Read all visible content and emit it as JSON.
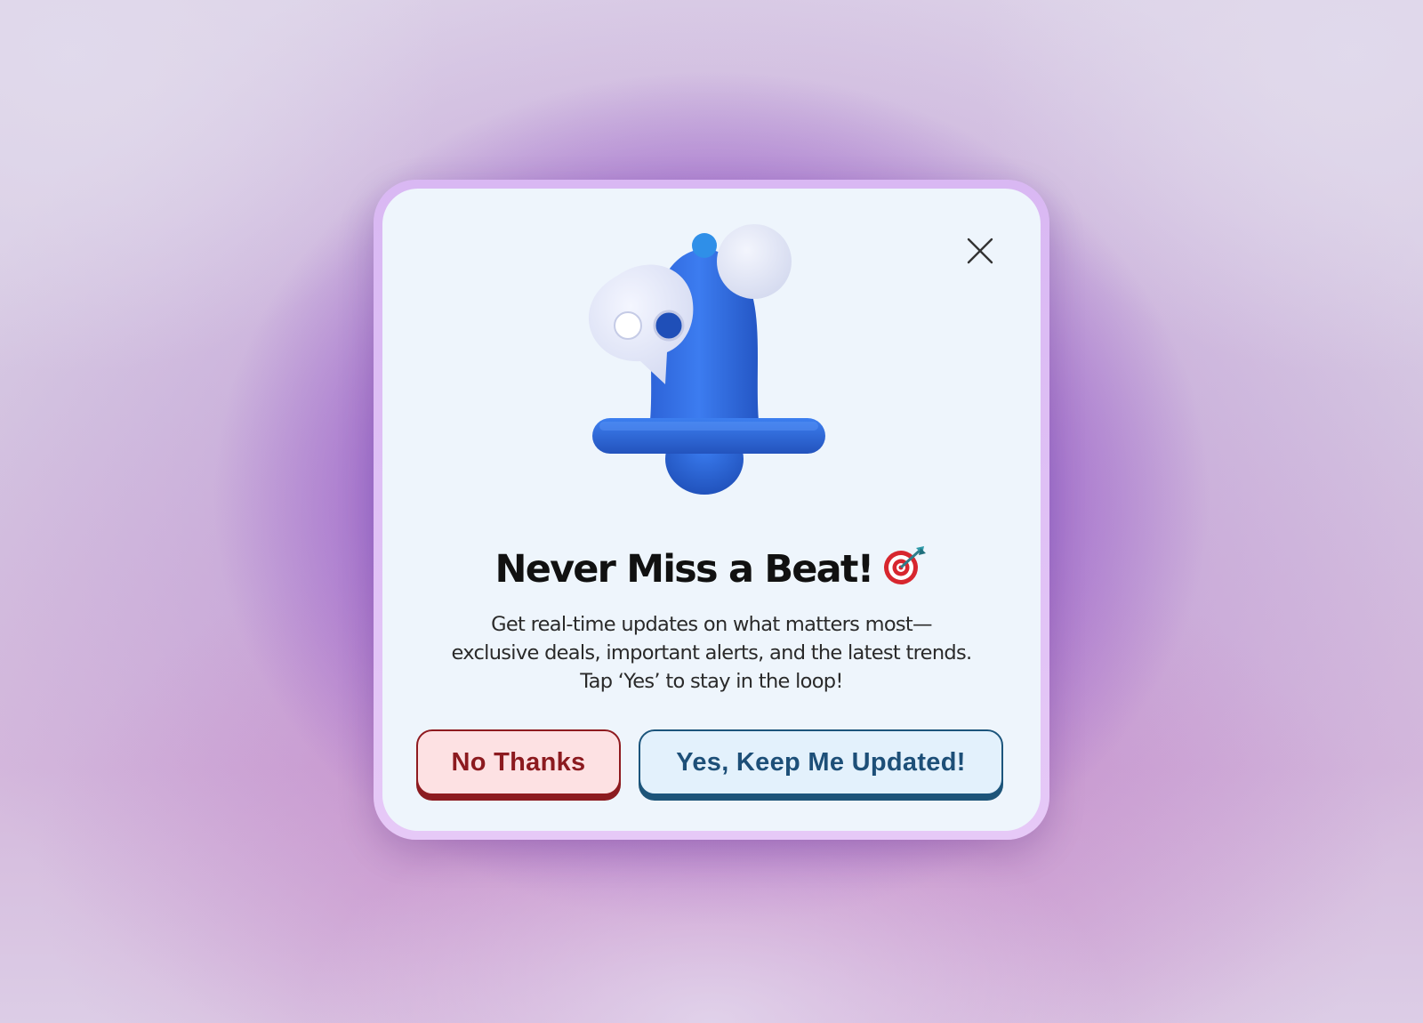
{
  "dialog": {
    "title": "Never Miss a Beat!",
    "title_icon": "dart-target-icon",
    "message_lines": [
      "Get real-time updates on what matters most—",
      "exclusive deals, important alerts, and the latest trends.",
      "Tap ‘Yes’ to stay in the loop!"
    ],
    "illustration": "notification-bell-illustration",
    "close_icon": "close-icon"
  },
  "buttons": {
    "decline_label": "No Thanks",
    "accept_label": "Yes, Keep Me Updated!"
  },
  "colors": {
    "bell_blue": "#2f6fe0",
    "decline_text": "#8c1a1f",
    "decline_bg": "#fde1e3",
    "accept_text": "#1d4f78",
    "accept_bg": "#e3f1fc",
    "dialog_bg": "#eef5fc",
    "frame": "#dcbaf4"
  }
}
